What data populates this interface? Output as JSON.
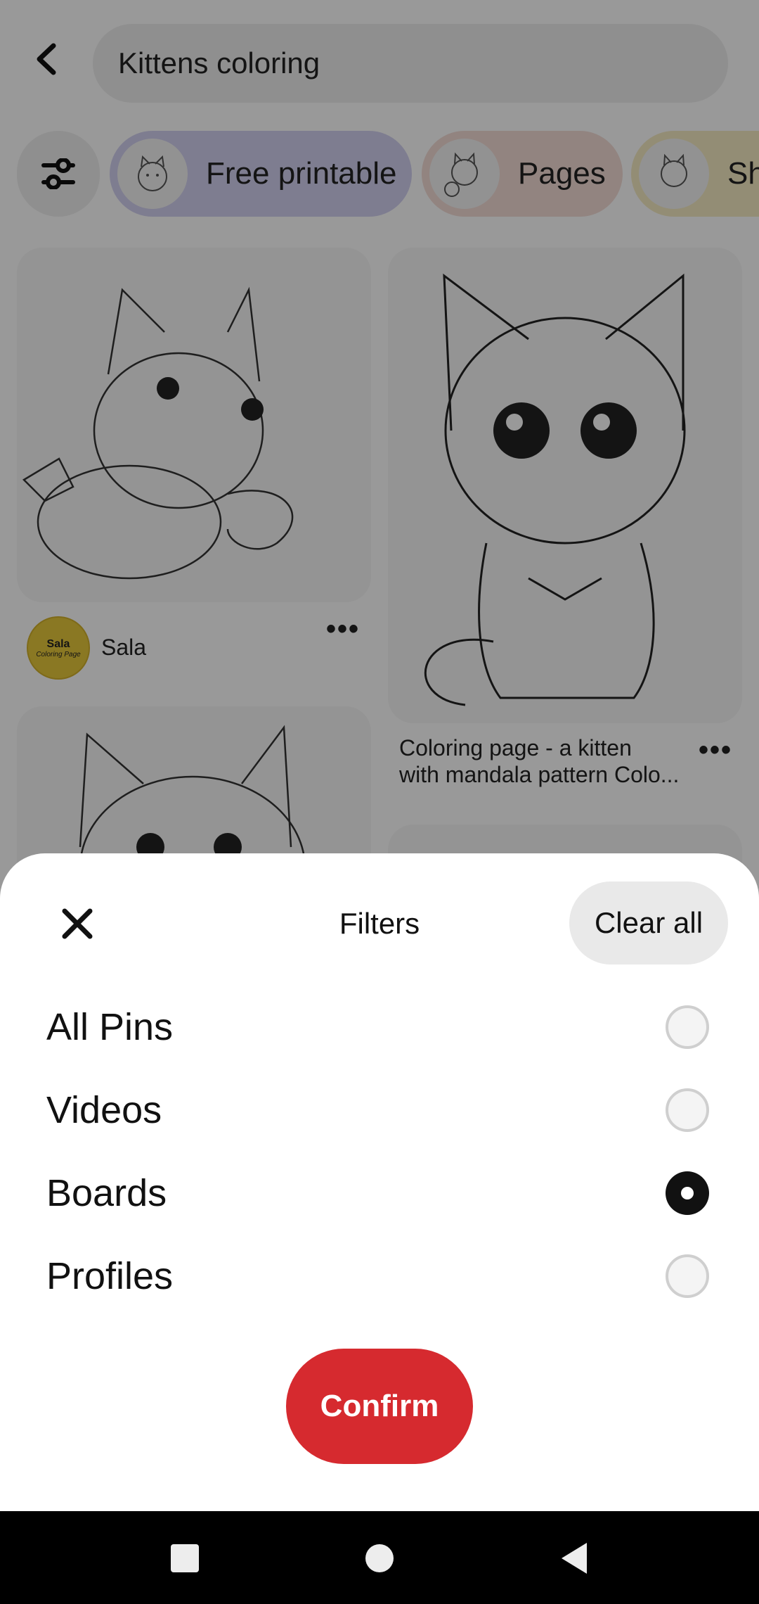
{
  "search": {
    "query": "Kittens coloring"
  },
  "chips": [
    {
      "label": "Free printable",
      "color": "#d3d1f1"
    },
    {
      "label": "Pages",
      "color": "#f3dcd6"
    },
    {
      "label": "Sh",
      "color": "#f6ebc4"
    }
  ],
  "pins": [
    {
      "author": "Sala",
      "avatar_text_1": "Sala",
      "avatar_text_2": "Coloring Page"
    },
    {
      "title_line1": "Coloring page - a kitten",
      "title_line2": "with mandala pattern Colo..."
    }
  ],
  "filters": {
    "title": "Filters",
    "clear_all": "Clear all",
    "options": [
      {
        "label": "All Pins",
        "selected": false
      },
      {
        "label": "Videos",
        "selected": false
      },
      {
        "label": "Boards",
        "selected": true
      },
      {
        "label": "Profiles",
        "selected": false
      }
    ],
    "confirm": "Confirm"
  },
  "colors": {
    "accent": "#d62a2f",
    "selected_radio": "#111111",
    "overlay": "rgba(0,0,0,0.40)"
  },
  "icons": {
    "back": "chevron-left-icon",
    "filter": "sliders-icon",
    "close": "close-icon",
    "more": "more-dots-icon",
    "nav_recents": "square-icon",
    "nav_home": "circle-icon",
    "nav_back": "triangle-icon"
  }
}
